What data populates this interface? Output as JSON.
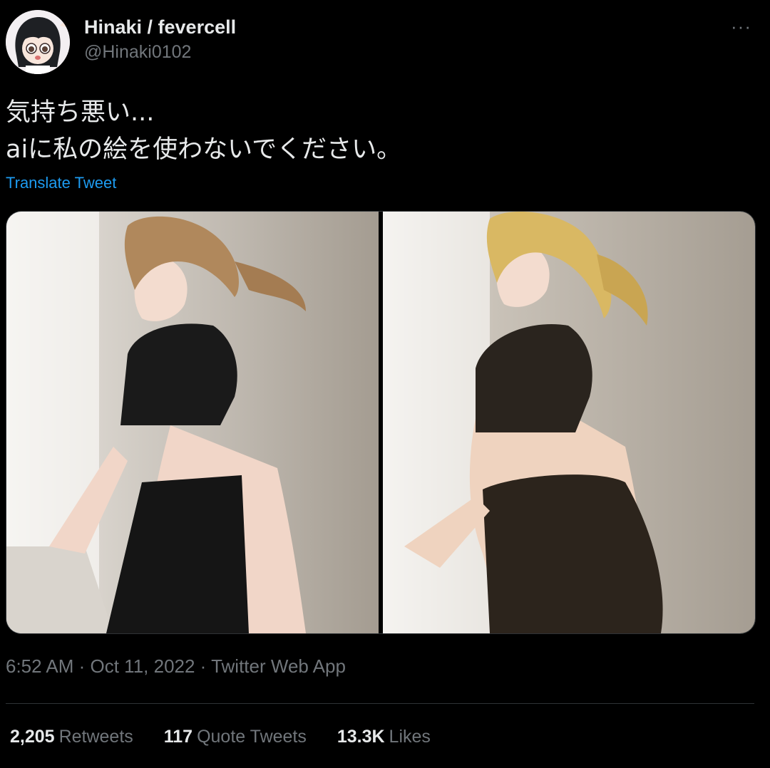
{
  "author": {
    "display_name": "Hinaki / fevercell",
    "handle": "@Hinaki0102"
  },
  "more_label": "···",
  "tweet": {
    "line1": "気持ち悪い...",
    "line2": "aiに私の絵を使わないでください。",
    "translate_label": "Translate Tweet"
  },
  "meta": {
    "text": "6:52 AM · Oct 11, 2022 · Twitter Web App"
  },
  "stats": {
    "retweets_count": "2,205",
    "retweets_label": "Retweets",
    "quotes_count": "117",
    "quotes_label": "Quote Tweets",
    "likes_count": "13.3K",
    "likes_label": "Likes"
  },
  "colors": {
    "background": "#000000",
    "primary_text": "#e7e9ea",
    "secondary_text": "#71767b",
    "link": "#1d9bf0",
    "divider": "#2f3336"
  },
  "icons": {
    "more": "more-horizontal-icon"
  }
}
